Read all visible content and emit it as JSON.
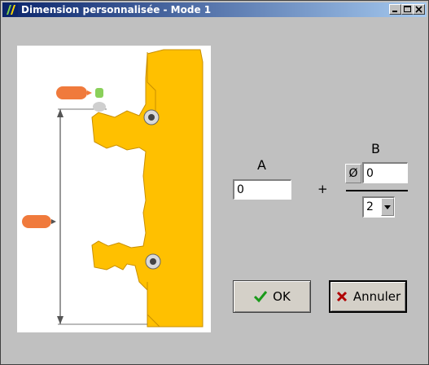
{
  "window": {
    "title": "Dimension personnalisée - Mode 1",
    "controls": [
      "minimize",
      "maximize",
      "close"
    ]
  },
  "form": {
    "label_a": "A",
    "label_b": "B",
    "plus": "+",
    "input_a_value": "0",
    "phi_symbol": "Ø",
    "input_b_value": "0",
    "divisor_value": "2"
  },
  "buttons": {
    "ok_label": "OK",
    "cancel_label": "Annuler"
  },
  "colors": {
    "part_fill": "#ffc000",
    "badge_orange": "#f07a3c",
    "badge_green": "#8ad05a",
    "ok_check": "#1a9a1a",
    "cancel_x": "#b00000"
  },
  "icons": {
    "app": "app-icon",
    "ok": "checkmark-icon",
    "cancel": "x-icon",
    "dropdown": "chevron-down-icon"
  }
}
